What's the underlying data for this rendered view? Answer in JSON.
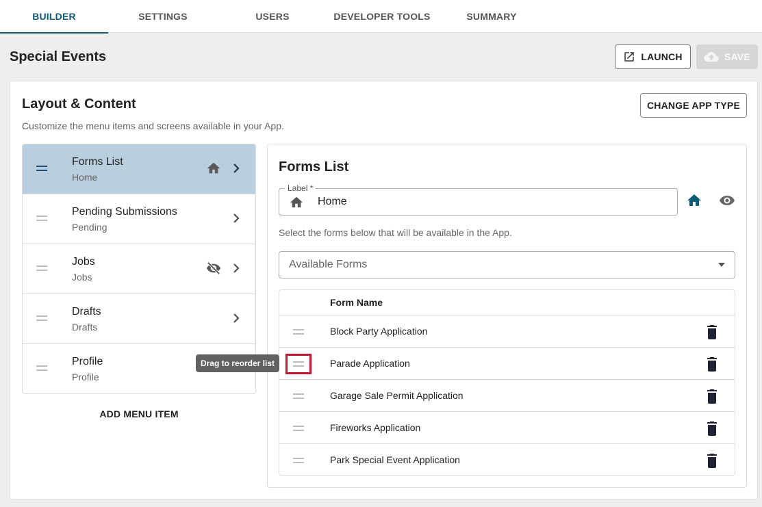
{
  "tabs": [
    {
      "label": "BUILDER",
      "active": true
    },
    {
      "label": "SETTINGS",
      "active": false
    },
    {
      "label": "USERS",
      "active": false
    },
    {
      "label": "DEVELOPER TOOLS",
      "active": false
    },
    {
      "label": "SUMMARY",
      "active": false
    }
  ],
  "page": {
    "title": "Special Events",
    "launch_label": "LAUNCH",
    "save_label": "SAVE"
  },
  "layout": {
    "title": "Layout & Content",
    "subtitle": "Customize the menu items and screens available in your App.",
    "change_app_type_label": "CHANGE APP TYPE",
    "add_menu_item_label": "ADD MENU ITEM"
  },
  "menu_items": [
    {
      "label": "Forms List",
      "sub": "Home",
      "icon": "home-icon",
      "active": true
    },
    {
      "label": "Pending Submissions",
      "sub": "Pending",
      "icon": null,
      "active": false
    },
    {
      "label": "Jobs",
      "sub": "Jobs",
      "icon": "eye-off-icon",
      "active": false
    },
    {
      "label": "Drafts",
      "sub": "Drafts",
      "icon": null,
      "active": false
    },
    {
      "label": "Profile",
      "sub": "Profile",
      "icon": null,
      "active": false
    }
  ],
  "detail": {
    "title": "Forms List",
    "label_legend": "Label *",
    "label_value": "Home",
    "select_hint": "Select the forms below that will be available in the App.",
    "available_forms_placeholder": "Available Forms",
    "column_header": "Form Name"
  },
  "forms": [
    "Block Party Application",
    "Parade Application",
    "Garage Sale Permit Application",
    "Fireworks Application",
    "Park Special Event Application"
  ],
  "tooltip": "Drag to reorder list",
  "colors": {
    "accent": "#0f5b75",
    "active_menu_bg": "#b9cfdd",
    "highlight_outline": "#c01832"
  }
}
